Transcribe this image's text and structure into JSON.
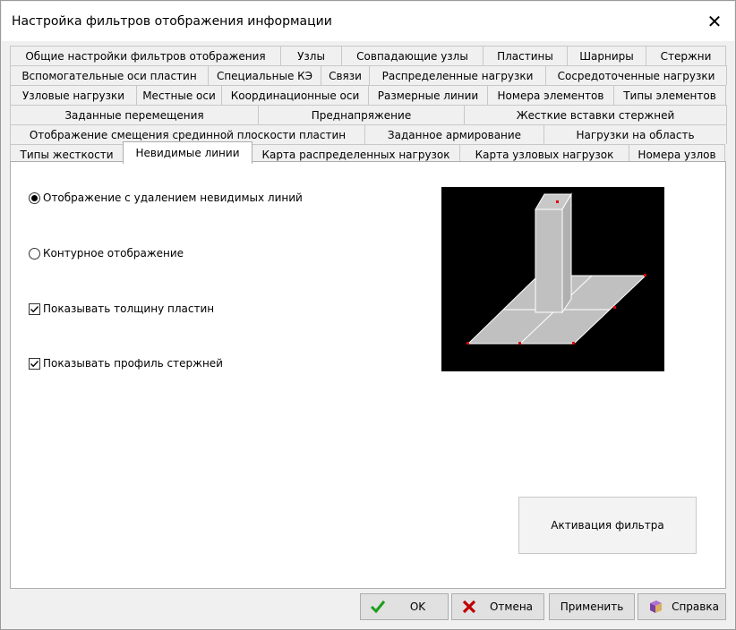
{
  "window": {
    "title": "Настройка фильтров отображения информации",
    "close_glyph": "✕"
  },
  "tabs": {
    "rows": [
      [
        "Типы жесткости",
        "Невидимые линии",
        "Карта распределенных нагрузок",
        "Карта узловых нагрузок",
        "Номера узлов"
      ],
      [
        "Отображение смещения срединной плоскости пластин",
        "Заданное армирование",
        "Нагрузки на область"
      ],
      [
        "Заданные перемещения",
        "Преднапряжение",
        "Жесткие вставки стержней"
      ],
      [
        "Узловые нагрузки",
        "Местные оси",
        "Координационные оси",
        "Размерные линии",
        "Номера элементов",
        "Типы элементов"
      ],
      [
        "Вспомогательные оси пластин",
        "Специальные КЭ",
        "Связи",
        "Распределенные нагрузки",
        "Сосредоточенные нагрузки"
      ],
      [
        "Общие настройки фильтров отображения",
        "Узлы",
        "Совпадающие узлы",
        "Пластины",
        "Шарниры",
        "Стержни"
      ]
    ],
    "active": "Невидимые линии"
  },
  "options": {
    "radio_hidden_removal": "Отображение с удалением невидимых линий",
    "radio_contour": "Контурное отображение",
    "check_plate_thickness": "Показывать толщину пластин",
    "check_bar_profile": "Показывать профиль стержней",
    "selected_radio": "radio_hidden_removal",
    "plate_thickness_checked": true,
    "bar_profile_checked": true
  },
  "activate_button": "Активация фильтра",
  "buttons": {
    "ok": "OK",
    "cancel": "Отмена",
    "apply": "Применить",
    "help": "Справка"
  },
  "colors": {
    "ok_check": "#1a9e1a",
    "cancel_x": "#c00000",
    "preview_bg": "#000000",
    "preview_fill": "#c0c0c0",
    "preview_node": "#e00000"
  },
  "icons": {
    "ok": "check-icon",
    "cancel": "x-icon",
    "help": "help-book-icon"
  }
}
